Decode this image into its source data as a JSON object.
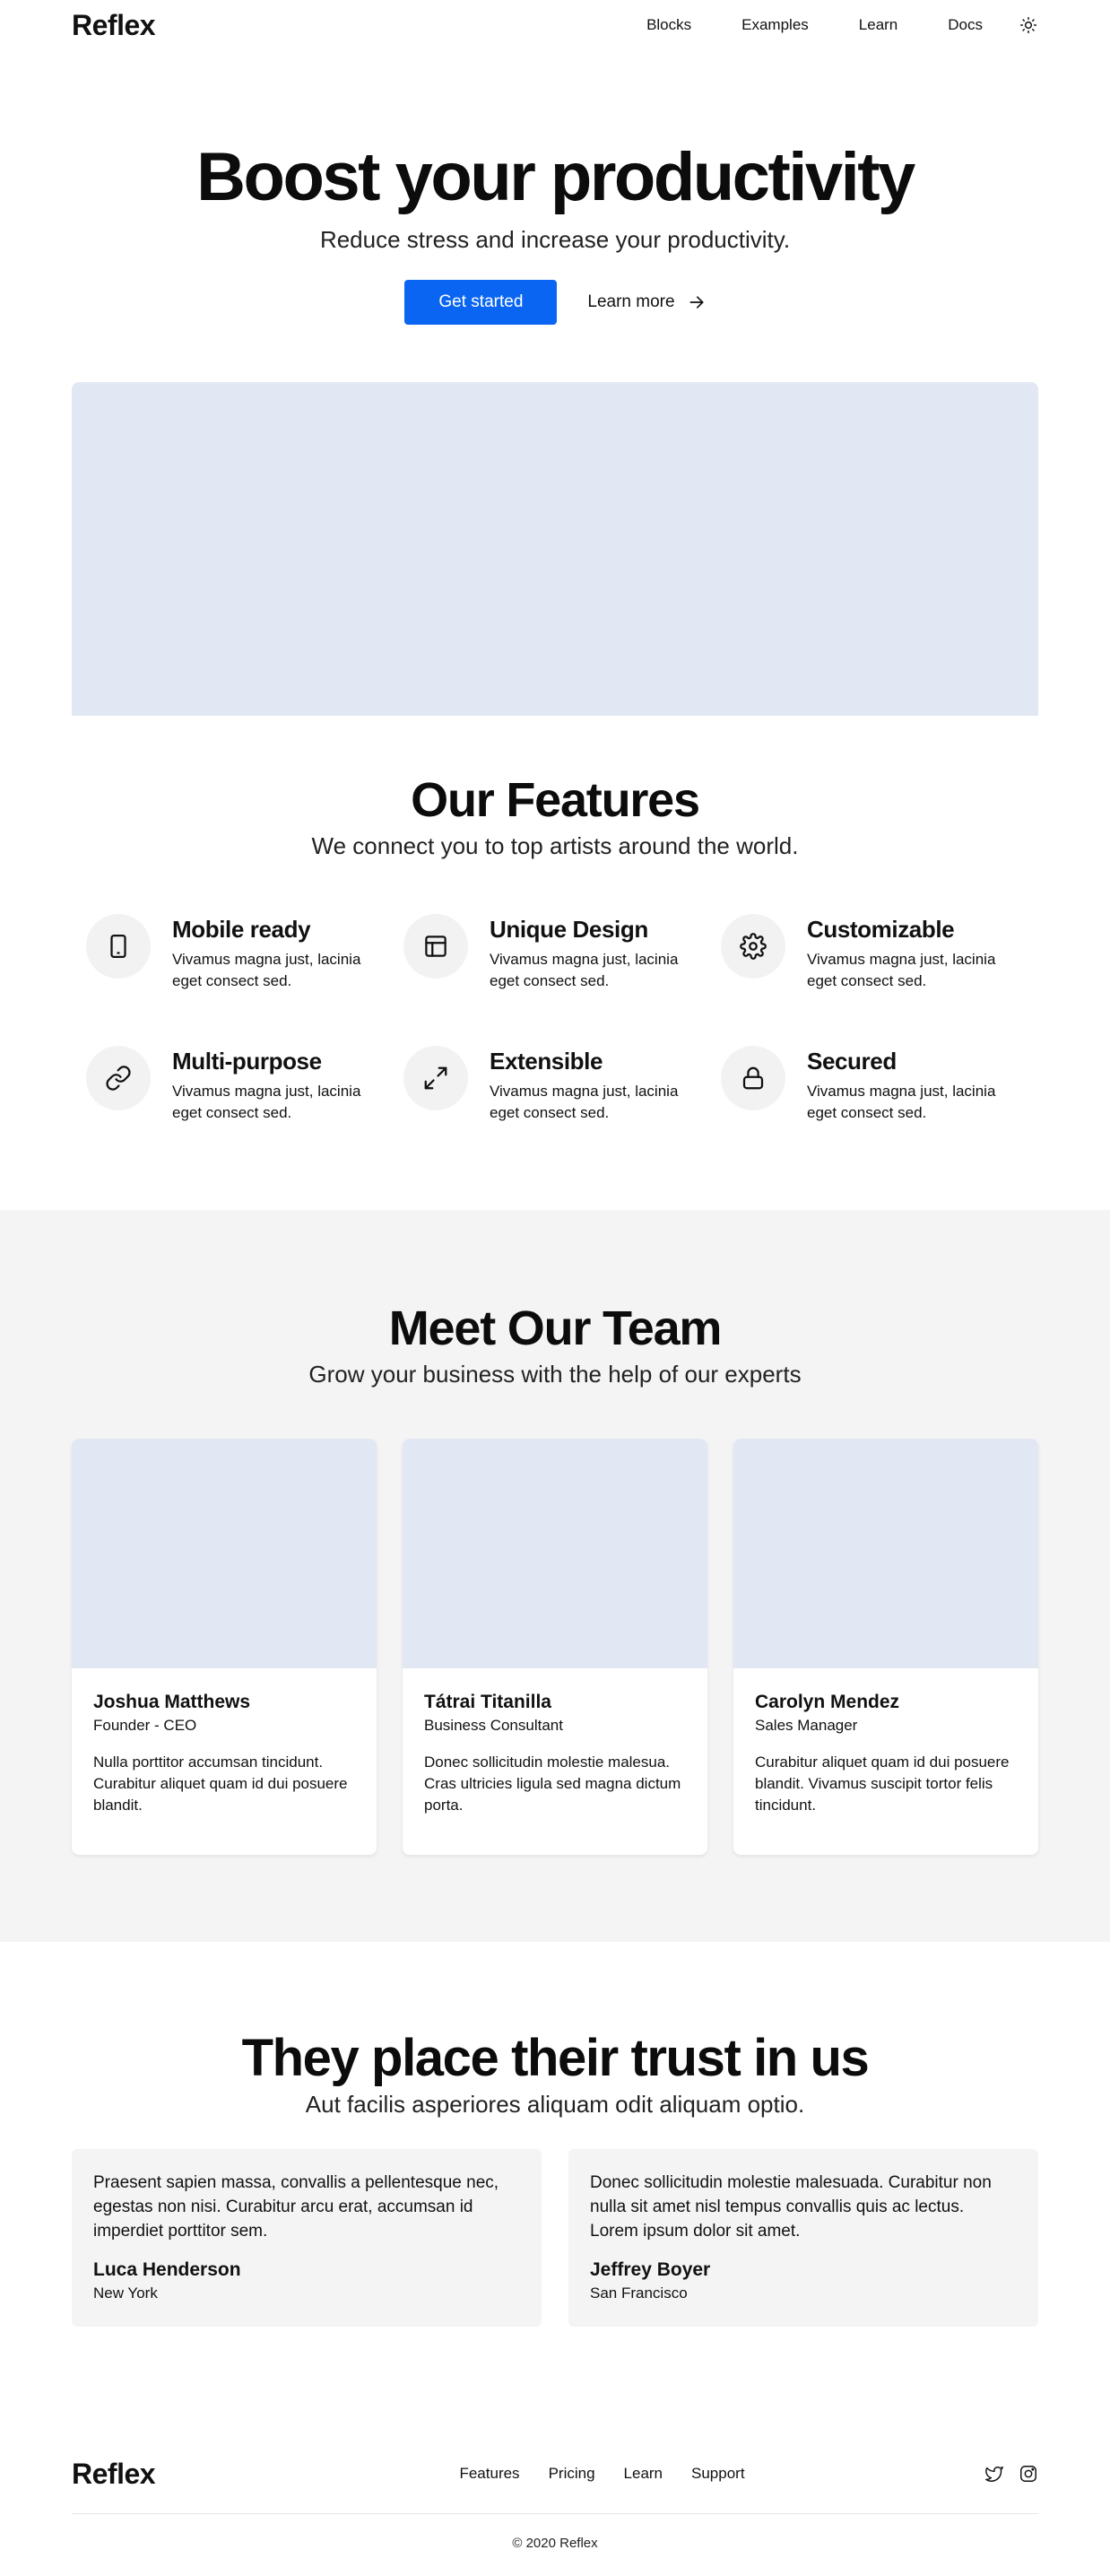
{
  "nav": {
    "logo": "Reflex",
    "links": [
      "Blocks",
      "Examples",
      "Learn",
      "Docs"
    ],
    "theme_icon": "sun-icon"
  },
  "hero": {
    "title": "Boost your productivity",
    "subtitle": "Reduce stress and increase your productivity.",
    "primary_cta": "Get started",
    "secondary_cta": "Learn more"
  },
  "features": {
    "title": "Our Features",
    "subtitle": "We connect you to top artists around the world.",
    "items": [
      {
        "icon": "tablet-icon",
        "title": "Mobile ready",
        "text": "Vivamus magna just, lacinia eget consect sed."
      },
      {
        "icon": "layout-icon",
        "title": "Unique Design",
        "text": "Vivamus magna just, lacinia eget consect sed."
      },
      {
        "icon": "gear-icon",
        "title": "Customizable",
        "text": "Vivamus magna just, lacinia eget consect sed."
      },
      {
        "icon": "link-icon",
        "title": "Multi-purpose",
        "text": "Vivamus magna just, lacinia eget consect sed."
      },
      {
        "icon": "expand-icon",
        "title": "Extensible",
        "text": "Vivamus magna just, lacinia eget consect sed."
      },
      {
        "icon": "lock-icon",
        "title": "Secured",
        "text": "Vivamus magna just, lacinia eget consect sed."
      }
    ]
  },
  "team": {
    "title": "Meet Our Team",
    "subtitle": "Grow your business with the help of our experts",
    "members": [
      {
        "name": "Joshua Matthews",
        "role": "Founder - CEO",
        "bio": "Nulla porttitor accumsan tincidunt. Curabitur aliquet quam id dui posuere blandit."
      },
      {
        "name": "Tátrai Titanilla",
        "role": "Business Consultant",
        "bio": "Donec sollicitudin molestie malesua. Cras ultricies ligula sed magna dictum porta."
      },
      {
        "name": "Carolyn Mendez",
        "role": "Sales Manager",
        "bio": "Curabitur aliquet quam id dui posuere blandit. Vivamus suscipit tortor felis tincidunt."
      }
    ]
  },
  "trust": {
    "title": "They place their trust in us",
    "subtitle": "Aut facilis asperiores aliquam odit aliquam optio.",
    "quotes": [
      {
        "text": "Praesent sapien massa, convallis a pellentesque nec, egestas non nisi. Curabitur arcu erat, accumsan id imperdiet porttitor sem.",
        "name": "Luca Henderson",
        "city": "New York"
      },
      {
        "text": "Donec sollicitudin molestie malesuada. Curabitur non nulla sit amet nisl tempus convallis quis ac lectus. Lorem ipsum dolor sit amet.",
        "name": "Jeffrey Boyer",
        "city": "San Francisco"
      }
    ]
  },
  "footer": {
    "logo": "Reflex",
    "links": [
      "Features",
      "Pricing",
      "Learn",
      "Support"
    ],
    "social_icons": [
      "twitter-icon",
      "instagram-icon"
    ],
    "copyright": "© 2020 Reflex"
  },
  "colors": {
    "accent": "#0a66f2",
    "placeholder": "#e2e8f3",
    "section_bg": "#f4f4f4"
  }
}
